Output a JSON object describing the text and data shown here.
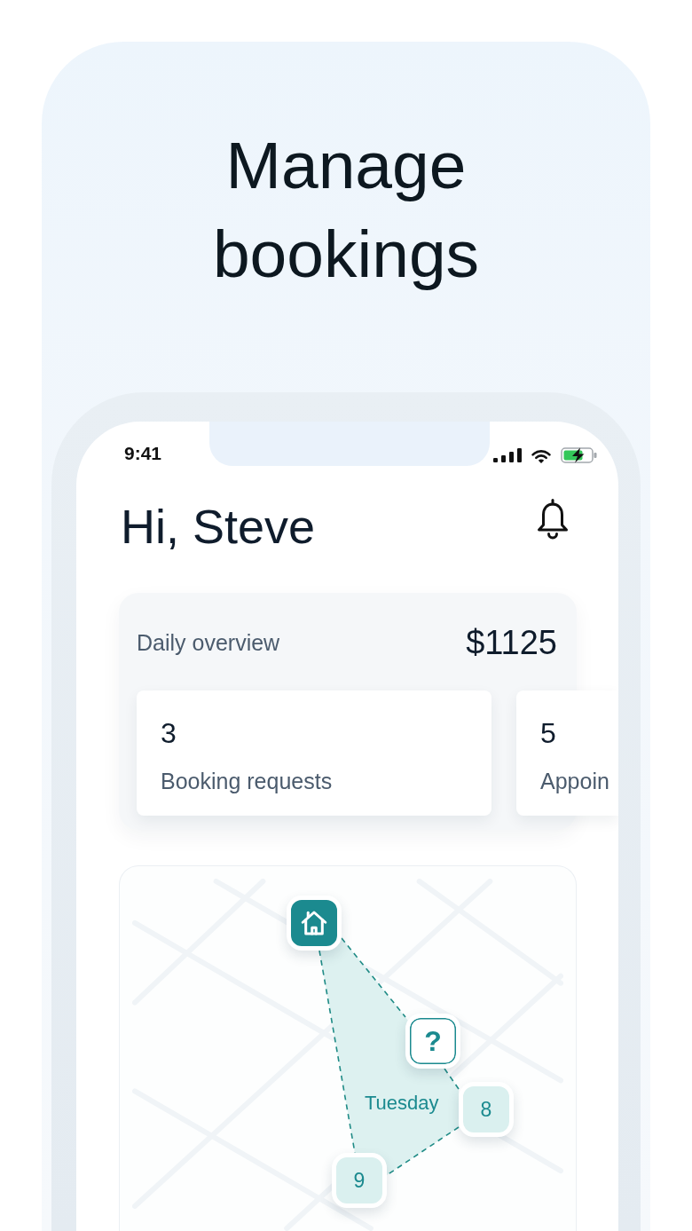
{
  "headline": "Manage bookings",
  "status_bar": {
    "time": "9:41"
  },
  "greeting": "Hi, Steve",
  "overview": {
    "title": "Daily overview",
    "total": "$1125",
    "stats": [
      {
        "value": "3",
        "label": "Booking requests"
      },
      {
        "value": "5",
        "label": "Appoin"
      }
    ]
  },
  "map": {
    "route_label": "Tuesday",
    "pins": [
      {
        "kind": "home"
      },
      {
        "kind": "unknown",
        "label": "?"
      },
      {
        "kind": "stop",
        "label": "8"
      },
      {
        "kind": "stop",
        "label": "9"
      }
    ]
  }
}
